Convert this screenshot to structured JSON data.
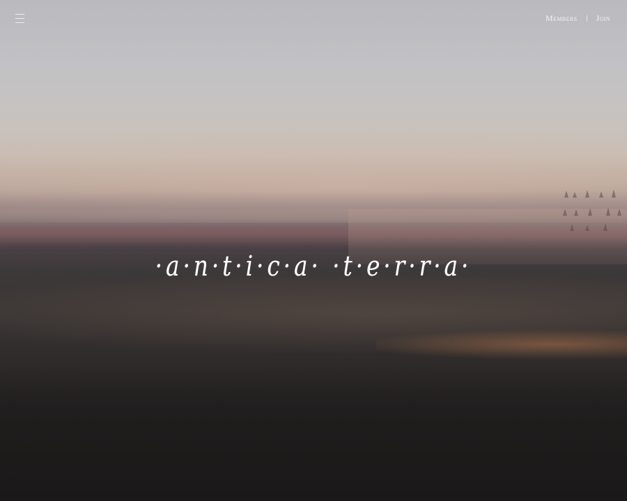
{
  "header": {
    "menu_icon": "hamburger-menu-icon",
    "nav": {
      "members_label": "Members",
      "join_label": "Join"
    }
  },
  "hero": {
    "logo_text": "·a·n·t·i·c·a· ·t·e·r·r·a·"
  },
  "colors": {
    "text": "#ffffff",
    "sky_top": "#c3c4c8",
    "horizon_warm": "#c9bdb4",
    "ground_dark": "#1f1c1c"
  }
}
